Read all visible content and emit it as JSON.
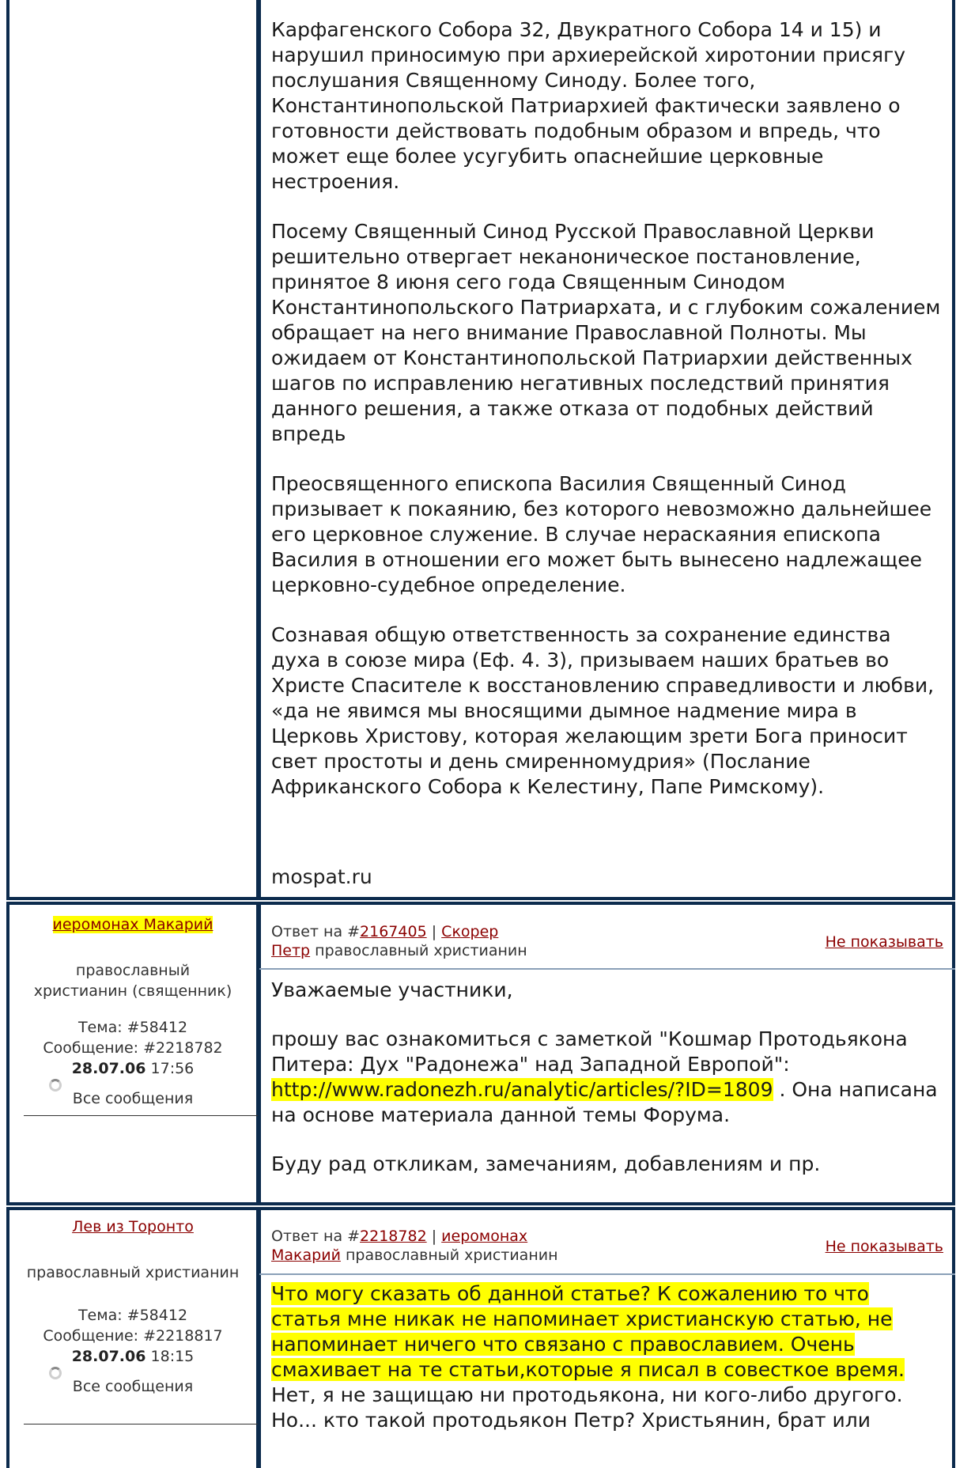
{
  "article": {
    "paragraphs": [
      "Карфагенского Собора 32, Двукратного Собора 14 и 15) и нарушил приносимую при архиерейской хиротонии присягу послушания Священному Синоду. Более того, Константинопольской Патриархией фактически заявлено о готовности действовать подобным образом и впредь, что может еще более усугубить опаснейшие церковные нестроения.",
      "Посему Священный Синод Русской Православной Церкви решительно отвергает неканоническое постановление, принятое 8 июня сего года Священным Синодом Константинопольского Патриархата, и с глубоким сожалением обращает на него внимание Православной Полноты. Мы ожидаем от Константинопольской Патриархии действенных шагов по исправлению негативных последствий принятия данного решения, а также отказа от подобных действий впредь",
      "Преосвященного епископа Василия Священный Синод призывает к покаянию, без которого невозможно дальнейшее его церковное служение. В случае нераскаяния епископа Василия в отношении его может быть вынесено надлежащее церковно-судебное определение.",
      "Сознавая общую ответственность за сохранение единства духа в союзе мира (Еф. 4. 3), призываем наших братьев во Христе Спасителе к восстановлению справедливости и любви, «да не явимся мы вносящими дымное надмение мира в Церковь Христову, которая желающим зрети Бога приносит свет простоты и день смиренномудрия» (Послание Африканского Собора к Келестину, Папе Римскому)."
    ],
    "source": "mospat.ru"
  },
  "posts": [
    {
      "author": "иеромонах Макарий",
      "role": "православный христианин (священник)",
      "topic": "Тема: #58412",
      "message_id": "Сообщение: #2218782",
      "date": "28.07.06",
      "time": "17:56",
      "all_messages": "Все сообщения",
      "reply_prefix": "Ответ на #",
      "reply_id": "2167405",
      "reply_sep": "|",
      "reply_to_1": "Скорер",
      "reply_to_2": "Петр",
      "reply_to_role": "православный христианин",
      "hide": "Не показывать",
      "body": {
        "p1": "Уважаемые участники,",
        "p2_pre": "прошу вас ознакомиться с заметкой \"Кошмар Протодьякона Питера: Дух \"Радонежа\" над Западной Европой\":",
        "p2_link": "http://www.radonezh.ru/analytic/articles/?ID=1809",
        "p2_post": " . Она написана на основе материала данной темы Форума.",
        "p3": "Буду рад откликам, замечаниям, добавлениям и пр."
      }
    },
    {
      "author": "Лев из Торонто",
      "role": "православный христианин",
      "topic": "Тема: #58412",
      "message_id": "Сообщение: #2218817",
      "date": "28.07.06",
      "time": "18:15",
      "all_messages": "Все сообщения",
      "reply_prefix": "Ответ на #",
      "reply_id": "2218782",
      "reply_sep": "|",
      "reply_to_1": "иеромонах",
      "reply_to_2": "Макарий",
      "reply_to_role": "православный христианин",
      "hide": "Не показывать",
      "body": {
        "highlighted": "Что могу сказать об данной статье? К сожалению то что статья мне никак не напоминает христианскую статью, не напоминает ничего что связано с православием. Очень смахивает на те статьи,которые я писал в совесткое время.",
        "plain": " Нет, я не защищаю ни протодьякона, ни кого-либо другого. Но... кто такой протодьякон Петр? Христьянин, брат или"
      }
    }
  ]
}
